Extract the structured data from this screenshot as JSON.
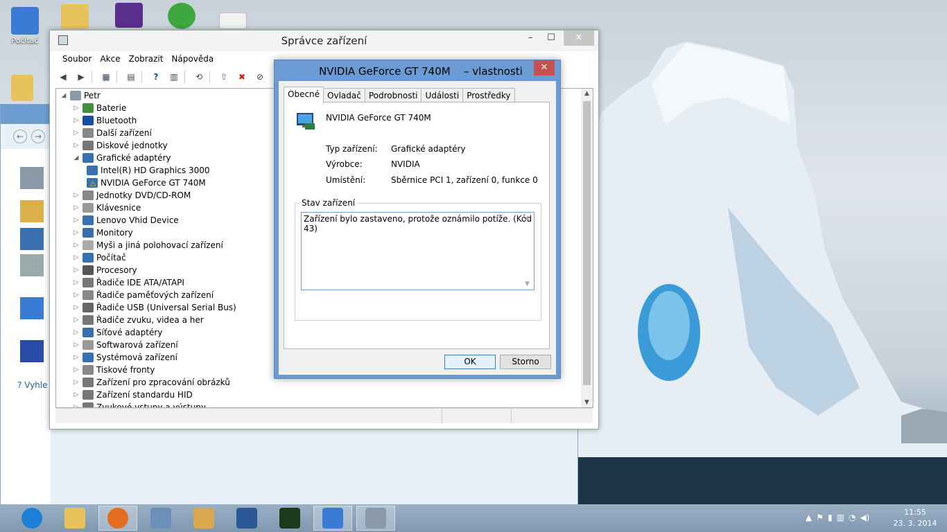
{
  "desktop": {
    "icons": [
      {
        "label": "Počítač",
        "color": "#3a7bd5"
      },
      {
        "label": "",
        "color": "#e8c25a"
      },
      {
        "label": "",
        "color": "#5a2e8c"
      },
      {
        "label": "",
        "color": "#3ea83e"
      },
      {
        "label": "",
        "color": "#f2f2f2"
      },
      {
        "label": "",
        "color": "#e8c25a"
      }
    ]
  },
  "bg_window": {
    "help_label": "Vyhle"
  },
  "device_manager": {
    "title": "Správce zařízení",
    "menu": [
      "Soubor",
      "Akce",
      "Zobrazit",
      "Nápověda"
    ],
    "root": "Petr",
    "tree": [
      {
        "label": "Baterie",
        "expanded": false,
        "child": false,
        "color": "#3f8f3f"
      },
      {
        "label": "Bluetooth",
        "expanded": false,
        "child": false,
        "color": "#1b4aa8"
      },
      {
        "label": "Další zařízení",
        "expanded": false,
        "child": false,
        "color": "#888"
      },
      {
        "label": "Diskové jednotky",
        "expanded": false,
        "child": false,
        "color": "#777"
      },
      {
        "label": "Grafické adaptéry",
        "expanded": true,
        "child": false,
        "color": "#3a6fb0"
      },
      {
        "label": "Intel(R) HD Graphics 3000",
        "expanded": false,
        "child": true,
        "color": "#3a6fb0"
      },
      {
        "label": "NVIDIA GeForce GT 740M",
        "expanded": false,
        "child": true,
        "color": "#3a6fb0",
        "warning": true
      },
      {
        "label": "Jednotky DVD/CD-ROM",
        "expanded": false,
        "child": false,
        "color": "#888"
      },
      {
        "label": "Klávesnice",
        "expanded": false,
        "child": false,
        "color": "#999"
      },
      {
        "label": "Lenovo Vhid Device",
        "expanded": false,
        "child": false,
        "color": "#3a6fb0"
      },
      {
        "label": "Monitory",
        "expanded": false,
        "child": false,
        "color": "#3a6fb0"
      },
      {
        "label": "Myši a jiná polohovací zařízení",
        "expanded": false,
        "child": false,
        "color": "#aaa"
      },
      {
        "label": "Počítač",
        "expanded": false,
        "child": false,
        "color": "#3a6fb0"
      },
      {
        "label": "Procesory",
        "expanded": false,
        "child": false,
        "color": "#555"
      },
      {
        "label": "Řadiče IDE ATA/ATAPI",
        "expanded": false,
        "child": false,
        "color": "#777"
      },
      {
        "label": "Řadiče paměťových zařízení",
        "expanded": false,
        "child": false,
        "color": "#888"
      },
      {
        "label": "Řadiče USB (Universal Serial Bus)",
        "expanded": false,
        "child": false,
        "color": "#666"
      },
      {
        "label": "Řadiče zvuku, videa a her",
        "expanded": false,
        "child": false,
        "color": "#777"
      },
      {
        "label": "Síťové adaptéry",
        "expanded": false,
        "child": false,
        "color": "#3a6fb0"
      },
      {
        "label": "Softwarová zařízení",
        "expanded": false,
        "child": false,
        "color": "#999"
      },
      {
        "label": "Systémová zařízení",
        "expanded": false,
        "child": false,
        "color": "#3a6fb0"
      },
      {
        "label": "Tiskové fronty",
        "expanded": false,
        "child": false,
        "color": "#888"
      },
      {
        "label": "Zařízení pro zpracování obrázků",
        "expanded": false,
        "child": false,
        "color": "#777"
      },
      {
        "label": "Zařízení standardu HID",
        "expanded": false,
        "child": false,
        "color": "#777"
      },
      {
        "label": "Zvukové vstupy a výstupy",
        "expanded": false,
        "child": false,
        "color": "#777"
      }
    ]
  },
  "properties": {
    "title": "NVIDIA GeForce GT 740M",
    "title_suffix": "– vlastnosti",
    "tabs": [
      "Obecné",
      "Ovladač",
      "Podrobnosti",
      "Události",
      "Prostředky"
    ],
    "active_tab": "Obecné",
    "device_name": "NVIDIA GeForce GT 740M",
    "fields": [
      {
        "label": "Typ zařízení:",
        "value": "Grafické adaptéry"
      },
      {
        "label": "Výrobce:",
        "value": "NVIDIA"
      },
      {
        "label": "Umístění:",
        "value": "Sběrnice PCI 1, zařízení 0, funkce 0"
      }
    ],
    "status_legend": "Stav zařízení",
    "status_text": "Zařízení bylo zastaveno, protože oznámilo potíže. (Kód 43)",
    "ok_label": "OK",
    "cancel_label": "Storno"
  },
  "taskbar": {
    "items": [
      {
        "name": "internet-explorer",
        "color": "#1e7fd6",
        "open": false
      },
      {
        "name": "file-explorer",
        "color": "#e8c25a",
        "open": false
      },
      {
        "name": "firefox",
        "color": "#e56b1f",
        "open": true
      },
      {
        "name": "calculator",
        "color": "#6a8fb8",
        "open": false
      },
      {
        "name": "paint",
        "color": "#d9a84e",
        "open": false
      },
      {
        "name": "word",
        "color": "#2b5797",
        "open": false
      },
      {
        "name": "monitor-app",
        "color": "#1a3a1a",
        "open": false
      },
      {
        "name": "control-panel",
        "color": "#3a7bd5",
        "open": true
      },
      {
        "name": "device-manager",
        "color": "#8a9aa8",
        "open": true
      }
    ],
    "time": "11:55",
    "date": "23. 3. 2014"
  }
}
